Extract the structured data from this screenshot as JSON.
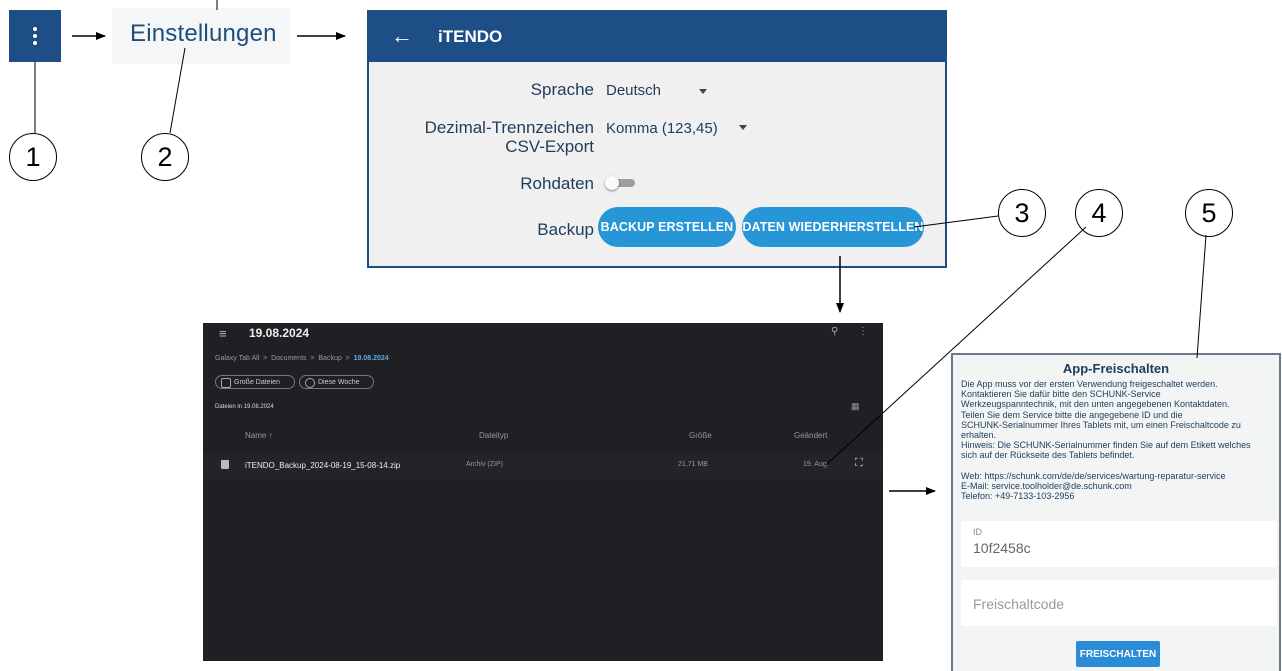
{
  "steps": {
    "menu_button_step": "1",
    "einstellungen_step": "2",
    "restore_step": "3",
    "file_step": "4",
    "unlock_step": "5"
  },
  "menu_word": "Einstellungen",
  "settings": {
    "title": "iTENDO",
    "sprache_label": "Sprache",
    "sprache_value": "Deutsch",
    "dezimal_label_line1": "Dezimal-Trennzeichen",
    "dezimal_label_line2": "CSV-Export",
    "dezimal_value": "Komma (123,45)",
    "rohdaten_label": "Rohdaten",
    "backup_label": "Backup",
    "backup_button": "BACKUP ERSTELLEN",
    "restore_button": "DATEN WIEDERHERSTELLEN"
  },
  "file_manager": {
    "title": "19.08.2024",
    "breadcrumb": [
      "Galaxy Tab All",
      "Documents",
      "Backup",
      "19.08.2024"
    ],
    "breadcrumb_sep": ">",
    "chips": [
      "Große Dateien",
      "Diese Woche"
    ],
    "section_label": "Dateien in 19.08.2024",
    "columns": {
      "name": "Name ↑",
      "type": "Dateityp",
      "size": "Größe",
      "changed": "Geändert"
    },
    "file": {
      "name": "iTENDO_Backup_2024-08-19_15-08-14.zip",
      "type": "Archiv (ZIP)",
      "size": "21,71 MB",
      "changed": "19. Aug."
    }
  },
  "unlock": {
    "title": "App-Freischalten",
    "text_lines": [
      "Die App muss vor der ersten Verwendung freigeschaltet werden.",
      "Kontaktieren Sie dafür bitte den SCHUNK-Service",
      "Werkzeugspanntechnik, mit den unten angegebenen Kontaktdaten.",
      "Teilen Sie dem Service bitte die angegebene ID und die",
      "SCHUNK-Serialnummer Ihres Tablets mit, um einen Freischaltcode zu",
      "erhalten.",
      "Hinweis: Die SCHUNK-Serialnummer finden Sie auf dem Etikett welches",
      "sich auf der Rückseite des Tablets befindet."
    ],
    "contact_lines": [
      "Web: https://schunk.com/de/de/services/wartung-reparatur-service",
      "E-Mail: service.toolholder@de.schunk.com",
      "Telefon: +49-7133-103-2956"
    ],
    "id_label": "ID",
    "id_value": "10f2458c",
    "code_placeholder": "Freischaltcode",
    "button": "FREISCHALTEN"
  },
  "colors": {
    "header_blue": "#1d4f86",
    "pill_blue": "#2796d6",
    "file_manager_bg": "#1f1f24",
    "breadcrumb_active": "#5fa8e8"
  }
}
